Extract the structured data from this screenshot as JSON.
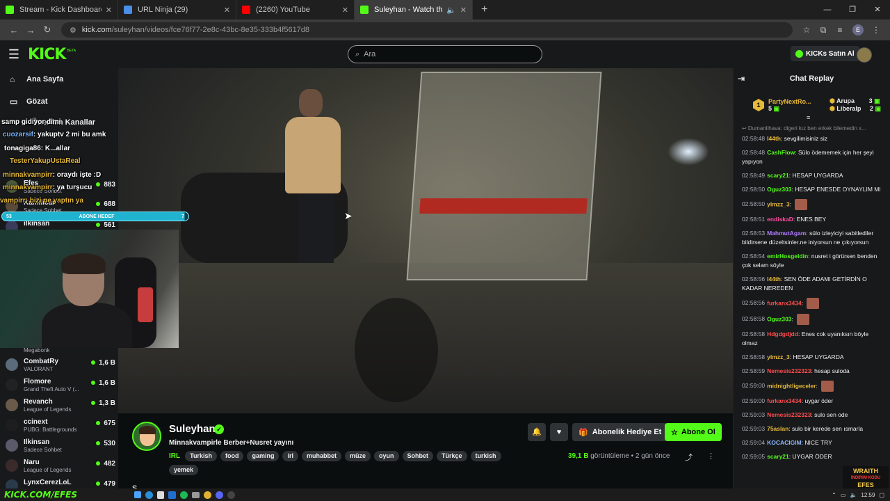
{
  "browser": {
    "tabs": [
      {
        "title": "Stream - Kick Dashboard",
        "color": "#53fc18"
      },
      {
        "title": "URL Ninja (29)",
        "color": "#4a8fe7"
      },
      {
        "title": "(2260) YouTube",
        "color": "#ff0000"
      },
      {
        "title": "Suleyhan - Watch the VOD",
        "color": "#53fc18"
      }
    ],
    "url_host": "kick.com",
    "url_path": "/suleyhan/videos/fce76f77-2e8c-43bc-8e35-333b4f5617d8",
    "profile_initial": "E"
  },
  "header": {
    "logo": "KICK",
    "beta": "BETA",
    "search_placeholder": "Ara",
    "kicks_button": "KICKs Satın Al"
  },
  "sidebar": {
    "nav": [
      {
        "label": "Ana Sayfa",
        "icon": "home-icon"
      },
      {
        "label": "Gözat",
        "icon": "browse-icon"
      }
    ],
    "section_title": "Önerilen Kanallar",
    "top_channels": [
      {
        "name": "Efes",
        "game": "Sadece Sohbet",
        "viewers": "883"
      },
      {
        "name": "Kamilican",
        "game": "Sadece Sohbet",
        "viewers": "688"
      },
      {
        "name": "ilkinsan",
        "game": "",
        "viewers": "561"
      }
    ],
    "channels": [
      {
        "name": "",
        "game": "Megabonk",
        "viewers": ""
      },
      {
        "name": "CombatRy",
        "game": "VALORANT",
        "viewers": "1,6 B"
      },
      {
        "name": "Flomore",
        "game": "Grand Theft Auto V (...",
        "viewers": "1,6 B"
      },
      {
        "name": "Revanch",
        "game": "League of Legends",
        "viewers": "1,3 B"
      },
      {
        "name": "ccinext",
        "game": "PUBG: Battlegrounds",
        "viewers": "675"
      },
      {
        "name": "Ilkinsan",
        "game": "Sadece Sohbet",
        "viewers": "530"
      },
      {
        "name": "Naru",
        "game": "League of Legends",
        "viewers": "482"
      },
      {
        "name": "LynxCerezLoL",
        "game": "",
        "viewers": "479"
      }
    ]
  },
  "overlay": {
    "lines": [
      {
        "user": "",
        "text": "samp gidiyor dimi"
      },
      {
        "user": "cuozarsif",
        "text": ": yakuptv 2 mi bu amk"
      },
      {
        "user": "",
        "text": "tonagiga86: K...allar"
      },
      {
        "user": "",
        "text": "TesterYakupUstaReal"
      },
      {
        "user": "minnakvampirr",
        "text": ": oraydı işte :D"
      },
      {
        "user": "minnakvampirr",
        "text": ": ya turşucu"
      },
      {
        "user": "",
        "text": "vampirr: bizi ne yaptın ya"
      }
    ],
    "subgoal_left": "53",
    "subgoal_label": "ABONE HEDEF",
    "subgoal_right": "7",
    "subgoal_progress": 0.98
  },
  "stream": {
    "name": "Suleyhan",
    "title": "Minnakvampirle Berber+Nusret yayını",
    "category": "IRL",
    "tags": [
      "Turkish",
      "food",
      "gaming",
      "irl",
      "muhabbet",
      "müze",
      "oyun",
      "Sohbet",
      "Türkçe",
      "turkish"
    ],
    "tag_extra": "yemek",
    "views_count": "39,1 B",
    "views_label": "görüntüleme",
    "age": "2 gün önce",
    "gift_button": "Abonelik Hediye Et",
    "subscribe_button": "Abone Ol",
    "cutoff_text": "S..."
  },
  "chat": {
    "title": "Chat Replay",
    "leaderboard": {
      "rank": "1",
      "user": "PartyNextRo...",
      "user_count": "5",
      "entries": [
        {
          "name": "Arupa",
          "count": "3"
        },
        {
          "name": "Liberalp",
          "count": "2"
        }
      ]
    },
    "reply_preview": "↩ Dumanlihava: digeri kız ben erkek bilemedin x...",
    "messages": [
      {
        "time": "02:58:48",
        "user": "I44th",
        "color": "#e6b93a",
        "text": "sevgilimisiniz siz"
      },
      {
        "time": "02:58:48",
        "user": "CashFlow",
        "color": "#53fc18",
        "text": "Sülo ödememek için her şeyi yapıyon"
      },
      {
        "time": "02:58:49",
        "user": "scary21",
        "color": "#53fc18",
        "text": "HESAP UYGARDA"
      },
      {
        "time": "02:58:50",
        "user": "Oguz303",
        "color": "#53fc18",
        "text": "HESAP ENESDE OYNAYLIM MI"
      },
      {
        "time": "02:58:50",
        "user": "ylmzz_3",
        "color": "#e6b93a",
        "text": ""
      },
      {
        "time": "02:58:51",
        "user": "endiskaD",
        "color": "#ff4fa3",
        "text": "ENES BEY"
      },
      {
        "time": "02:58:53",
        "user": "MahmutAgam",
        "color": "#b07cff",
        "text": "sülo izleyiciyi sabitlediler bildirsene düzeltsinler.ne iniyorsun ne çıkıyorsun"
      },
      {
        "time": "02:58:54",
        "user": "emirHosgeldin",
        "color": "#53fc18",
        "text": "nusret i görürsen benden çok selam söyle"
      },
      {
        "time": "02:58:56",
        "user": "I44th",
        "color": "#e6b93a",
        "text": "SEN ÖDE ADAMI GETİRDİN O KADAR NEREDEN"
      },
      {
        "time": "02:58:56",
        "user": "furkanx3434",
        "color": "#ff4d4d",
        "text": ""
      },
      {
        "time": "02:58:58",
        "user": "Oguz303",
        "color": "#53fc18",
        "text": ""
      },
      {
        "time": "02:58:58",
        "user": "Hdgdgdjdd",
        "color": "#ff4d4d",
        "text": "Enes cok uyanıksın böyle olmaz"
      },
      {
        "time": "02:58:58",
        "user": "ylmzz_3",
        "color": "#e6b93a",
        "text": "HESAP UYGARDA"
      },
      {
        "time": "02:58:59",
        "user": "Nemesis232323",
        "color": "#ff4d4d",
        "text": "hesap suloda"
      },
      {
        "time": "02:59:00",
        "user": "midnightligeceler",
        "color": "#e6b93a",
        "text": ""
      },
      {
        "time": "02:59:00",
        "user": "furkanx3434",
        "color": "#ff4d4d",
        "text": "uygar öder"
      },
      {
        "time": "02:59:03",
        "user": "Nemesis232323",
        "color": "#ff4d4d",
        "text": "sulo sen ode"
      },
      {
        "time": "02:59:03",
        "user": "75aslan",
        "color": "#e6b93a",
        "text": "sulo bir kerede sen ısmarla"
      },
      {
        "time": "02:59:04",
        "user": "KOCACIGIM",
        "color": "#8fb8ff",
        "text": "NICE TRY"
      },
      {
        "time": "02:59:05",
        "user": "scary21",
        "color": "#53fc18",
        "text": "UYGAR ÖDER"
      }
    ],
    "ad_line1": "WRAITH",
    "ad_line2": "INDIRIM KODU",
    "ad_line3": "EFES"
  },
  "taskbar": {
    "brand": "KICK.COM/EFES",
    "clock": "12:59"
  },
  "colors": {
    "accent": "#53fc18",
    "bg": "#0b0e0f",
    "panel": "#18191b"
  }
}
